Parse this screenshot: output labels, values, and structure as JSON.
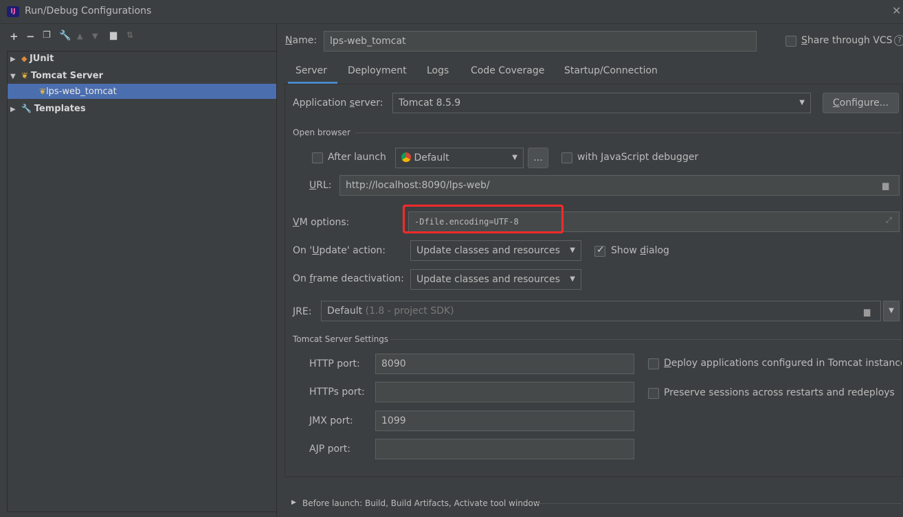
{
  "window": {
    "title": "Run/Debug Configurations",
    "app_icon_text": "IJ"
  },
  "toolbar": {
    "icons": [
      "add-icon",
      "remove-icon",
      "copy-icon",
      "wrench-icon",
      "move-up-icon",
      "move-down-icon",
      "folder-icon",
      "sort-icon"
    ]
  },
  "tree": {
    "items": [
      {
        "label": "JUnit"
      },
      {
        "label": "Tomcat Server"
      },
      {
        "label": "lps-web_tomcat"
      },
      {
        "label": "Templates"
      }
    ]
  },
  "header": {
    "name_label": "Name:",
    "name_value": "lps-web_tomcat",
    "share_label": "Share through VCS",
    "help_icon": "?"
  },
  "tabs": [
    "Server",
    "Deployment",
    "Logs",
    "Code Coverage",
    "Startup/Connection"
  ],
  "server": {
    "app_server_label": "Application server:",
    "app_server_value": "Tomcat 8.5.9",
    "configure_label": "Configure...",
    "open_browser_label": "Open browser",
    "after_launch_label": "After launch",
    "browser_value": "Default",
    "ellipsis_label": "...",
    "js_debugger_label": "with JavaScript debugger",
    "url_label": "URL:",
    "url_value": "http://localhost:8090/lps-web/",
    "vm_options_label": "VM options:",
    "vm_options_value": "-Dfile.encoding=UTF-8",
    "update_action_label": "On 'Update' action:",
    "update_action_value": "Update classes and resources",
    "show_dialog_label": "Show dialog",
    "frame_deactivation_label": "On frame deactivation:",
    "frame_deactivation_value": "Update classes and resources",
    "jre_label": "JRE:",
    "jre_value": "Default",
    "jre_hint": "(1.8 - project SDK)",
    "tomcat_settings_label": "Tomcat Server Settings",
    "http_port_label": "HTTP port:",
    "http_port_value": "8090",
    "https_port_label": "HTTPs port:",
    "https_port_value": "",
    "jmx_port_label": "JMX port:",
    "jmx_port_value": "1099",
    "ajp_port_label": "AJP port:",
    "ajp_port_value": "",
    "deploy_apps_label": "Deploy applications configured in Tomcat instance",
    "preserve_sessions_label": "Preserve sessions across restarts and redeploys"
  },
  "before_launch": {
    "label": "Before launch: Build, Build Artifacts, Activate tool window"
  },
  "colors": {
    "accent": "#4b6eaf",
    "highlight": "#ff2a2a",
    "background": "#3c3f41"
  }
}
